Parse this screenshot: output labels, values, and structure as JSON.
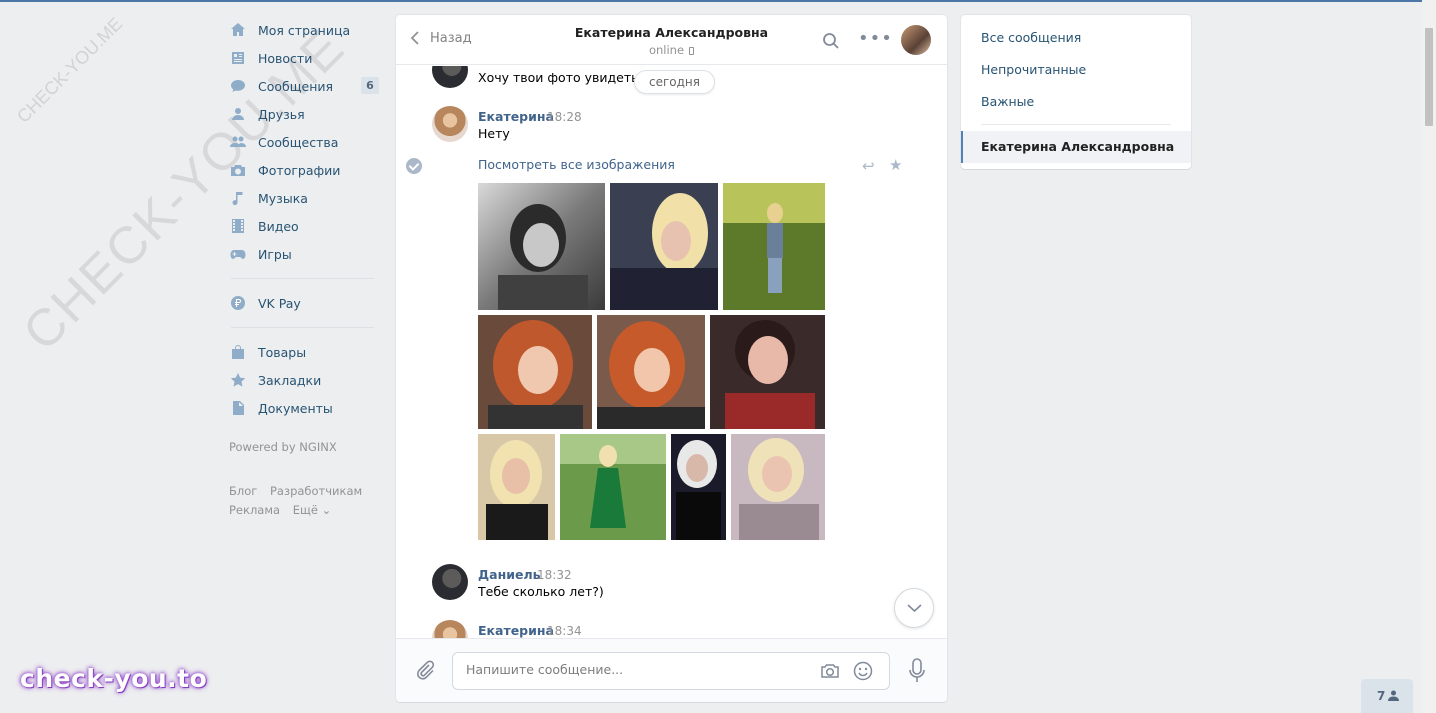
{
  "watermark": {
    "big": "CHECK-YOU.ME",
    "small": "CHECK-YOU.ME",
    "bottom": "check-you.to"
  },
  "nav": {
    "items": [
      {
        "label": "Моя страница",
        "icon": "home-icon"
      },
      {
        "label": "Новости",
        "icon": "news-icon"
      },
      {
        "label": "Сообщения",
        "icon": "messages-icon",
        "badge": "6"
      },
      {
        "label": "Друзья",
        "icon": "friends-icon"
      },
      {
        "label": "Сообщества",
        "icon": "groups-icon"
      },
      {
        "label": "Фотографии",
        "icon": "camera-icon"
      },
      {
        "label": "Музыка",
        "icon": "music-icon"
      },
      {
        "label": "Видео",
        "icon": "video-icon"
      },
      {
        "label": "Игры",
        "icon": "games-icon"
      }
    ],
    "vkpay": "VK Pay",
    "items2": [
      {
        "label": "Товары",
        "icon": "bag-icon"
      },
      {
        "label": "Закладки",
        "icon": "star-icon"
      },
      {
        "label": "Документы",
        "icon": "document-icon"
      }
    ],
    "powered": "Powered by NGINX",
    "footer": {
      "blog": "Блог",
      "dev": "Разработчикам",
      "ads": "Реклама",
      "more": "Ещё ⌄"
    }
  },
  "chat": {
    "back": "Назад",
    "name": "Екатерина Александровна",
    "status": "online",
    "date_pill": "сегодня",
    "messages": [
      {
        "text": "Хочу твои фото увидеть…(…)"
      },
      {
        "author": "Екатерина",
        "time": "18:28",
        "text": "Нету"
      },
      {
        "author": "Даниель",
        "time": "18:32",
        "text": "Тебе сколько лет?)"
      },
      {
        "author": "Екатерина",
        "time": "18:34"
      }
    ],
    "see_all": "Посмотреть все изображения",
    "composer_placeholder": "Напишите сообщение..."
  },
  "right": {
    "all": "Все сообщения",
    "unread": "Непрочитанные",
    "important": "Важные",
    "active": "Екатерина Александровна"
  },
  "friends_count": "7",
  "colors": {
    "accent": "#4a76a8",
    "link": "#285473",
    "author": "#42648b",
    "bg": "#edeef0"
  }
}
